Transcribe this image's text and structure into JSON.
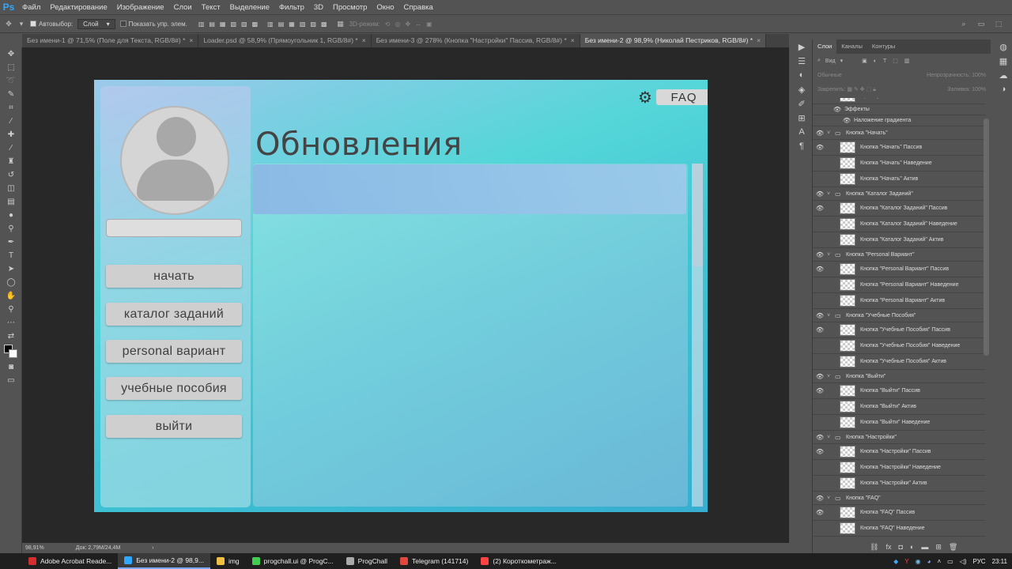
{
  "app": {
    "logo": "Ps"
  },
  "menubar": [
    "Файл",
    "Редактирование",
    "Изображение",
    "Слои",
    "Текст",
    "Выделение",
    "Фильтр",
    "3D",
    "Просмотр",
    "Окно",
    "Справка"
  ],
  "options": {
    "autoselect": "Автовыбор:",
    "layer_select": "Слой",
    "show_controls": "Показать упр. элем.",
    "mode_3d": "3D-режим:"
  },
  "doc_tabs": [
    "Без имени-1 @ 71,5% (Поле для Текста, RGB/8#) *",
    "Loader.psd @ 58,9% (Прямоугольник 1, RGB/8#) *",
    "Без имени-3 @ 278% (Кнопка \"Настройки\" Пассив, RGB/8#) *",
    "Без имени-2 @ 98,9% (Николай Пестриков, RGB/8#) *"
  ],
  "doc": {
    "title": "Обновления",
    "faq": "FAQ",
    "nav": [
      "начать",
      "каталог заданий",
      "personal вариант",
      "учебные пособия",
      "выйти"
    ]
  },
  "status": {
    "zoom": "98,91%",
    "doc_size": "Док: 2,79M/24,4M"
  },
  "layers": {
    "tabs": [
      "Слои",
      "Каналы",
      "Контуры"
    ],
    "filter": "Вид",
    "blend": "Обычные",
    "opacity_label": "Непрозрачность:",
    "opacity": "100%",
    "lock_label": "Закрепить:",
    "fill_label": "Заливка:",
    "fill": "100%",
    "rows": [
      {
        "type": "layer",
        "name": "Прямоугольник 1",
        "eye": false
      },
      {
        "type": "fx",
        "name": "Эффекты",
        "eye": true
      },
      {
        "type": "fx2",
        "name": "Наложение градиента",
        "eye": true
      },
      {
        "type": "group",
        "name": "Кнопка \"Начать\"",
        "eye": true
      },
      {
        "type": "layer",
        "name": "Кнопка \"Начать\" Пассив",
        "eye": true
      },
      {
        "type": "layer",
        "name": "Кнопка \"Начать\" Наведение",
        "eye": false
      },
      {
        "type": "layer",
        "name": "Кнопка \"Начать\" Актив",
        "eye": false
      },
      {
        "type": "group",
        "name": "Кнопка \"Каталог Заданий\"",
        "eye": true
      },
      {
        "type": "layer",
        "name": "Кнопка \"Каталог Заданий\" Пассив",
        "eye": true
      },
      {
        "type": "layer",
        "name": "Кнопка \"Каталог Заданий\" Наведение",
        "eye": false
      },
      {
        "type": "layer",
        "name": "Кнопка \"Каталог Заданий\" Актив",
        "eye": false
      },
      {
        "type": "group",
        "name": "Кнопка \"Personal Вариант\"",
        "eye": true
      },
      {
        "type": "layer",
        "name": "Кнопка \"Personal Вариант\" Пассив",
        "eye": true
      },
      {
        "type": "layer",
        "name": "Кнопка \"Personal Вариант\" Наведение",
        "eye": false
      },
      {
        "type": "layer",
        "name": "Кнопка \"Personal Вариант\" Актив",
        "eye": false
      },
      {
        "type": "group",
        "name": "Кнопка \"Учебные Пособия\"",
        "eye": true
      },
      {
        "type": "layer",
        "name": "Кнопка \"Учебные Пособия\" Пассив",
        "eye": true
      },
      {
        "type": "layer",
        "name": "Кнопка \"Учебные Пособия\" Наведение",
        "eye": false
      },
      {
        "type": "layer",
        "name": "Кнопка \"Учебные Пособия\" Актив",
        "eye": false
      },
      {
        "type": "group",
        "name": "Кнопка \"Выйти\"",
        "eye": true
      },
      {
        "type": "layer",
        "name": "Кнопка \"Выйти\" Пассив",
        "eye": true
      },
      {
        "type": "layer",
        "name": "Кнопка \"Выйти\" Актив",
        "eye": false
      },
      {
        "type": "layer",
        "name": "Кнопка \"Выйти\" Наведение",
        "eye": false
      },
      {
        "type": "group",
        "name": "Кнопка \"Настройки\"",
        "eye": true
      },
      {
        "type": "layer",
        "name": "Кнопка \"Настройки\" Пассив",
        "eye": true
      },
      {
        "type": "layer",
        "name": "Кнопка \"Настройки\" Наведение",
        "eye": false
      },
      {
        "type": "layer",
        "name": "Кнопка \"Настройки\" Актив",
        "eye": false
      },
      {
        "type": "group",
        "name": "Кнопка \"FAQ\"",
        "eye": true
      },
      {
        "type": "layer",
        "name": "Кнопка \"FAQ\" Пассив",
        "eye": true
      },
      {
        "type": "layer",
        "name": "Кнопка \"FAQ\" Наведение",
        "eye": false
      }
    ]
  },
  "taskbar": [
    {
      "label": "Adobe Acrobat Reade...",
      "color": "#d32f2f",
      "active": false
    },
    {
      "label": "Без имени-2 @ 98,9...",
      "color": "#31a8ff",
      "active": true
    },
    {
      "label": "img",
      "color": "#f0c040",
      "active": false
    },
    {
      "label": "progchall.ui @ ProgC...",
      "color": "#41cd52",
      "active": false
    },
    {
      "label": "ProgChall",
      "color": "#aaaaaa",
      "active": false
    },
    {
      "label": "Telegram (141714)",
      "color": "#e0483e",
      "active": false
    },
    {
      "label": "(2) Короткометраж...",
      "color": "#ff4444",
      "active": false
    }
  ],
  "tray": {
    "lang": "РУС",
    "time": "23:11"
  },
  "colors": {
    "accent": "#31a8ff",
    "canvas_bg": "#282828",
    "panel_bg": "#535353"
  }
}
